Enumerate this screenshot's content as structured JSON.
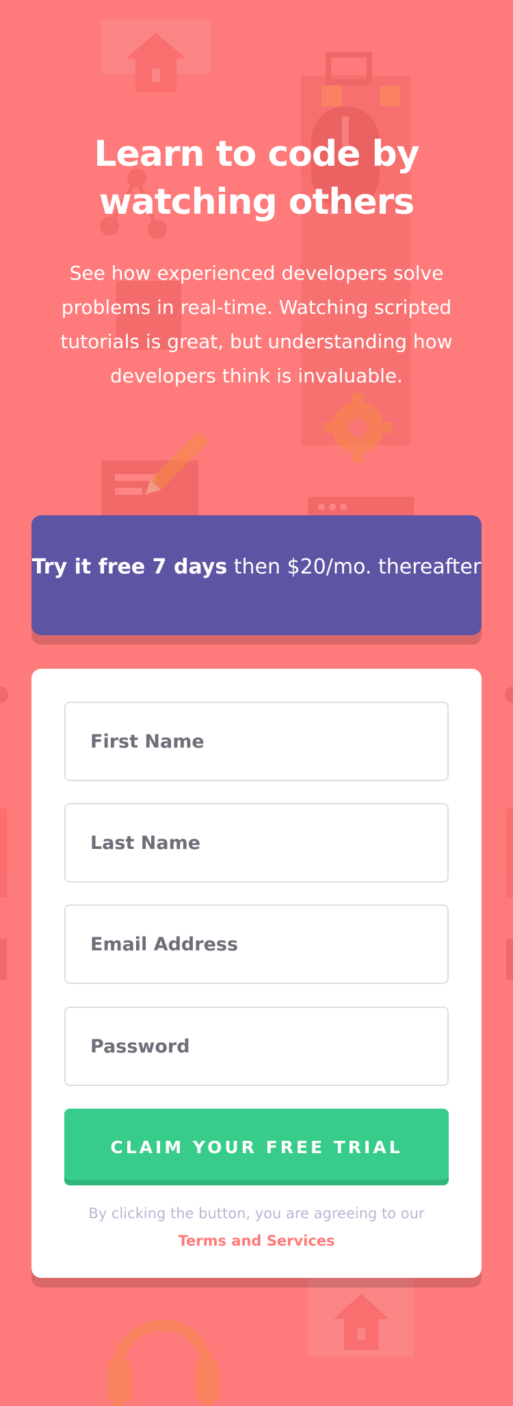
{
  "hero": {
    "title": "Learn to code by watching others",
    "text": "See how experienced developers solve problems in real-time. Watching scripted tutorials is great, but understanding how developers think is invaluable."
  },
  "offer": {
    "bold": "Try it free 7 days",
    "rest": " then $20/mo. thereafter"
  },
  "form": {
    "first_name_placeholder": "First Name",
    "last_name_placeholder": "Last Name",
    "email_placeholder": "Email Address",
    "password_placeholder": "Password",
    "submit_label": "CLAIM YOUR FREE TRIAL",
    "terms_prefix": "By clicking the button, you are agreeing to our ",
    "terms_link": "Terms and Services"
  },
  "colors": {
    "background": "#ff7a7a",
    "offer": "#5e54a4",
    "button": "#38cc8b",
    "terms_text": "#b9b6d3",
    "field_border": "#dedede"
  },
  "icons": [
    "house-icon",
    "bag-icon",
    "mouse-icon",
    "gear-icon",
    "pencil-icon",
    "headphones-icon",
    "document-icon"
  ]
}
